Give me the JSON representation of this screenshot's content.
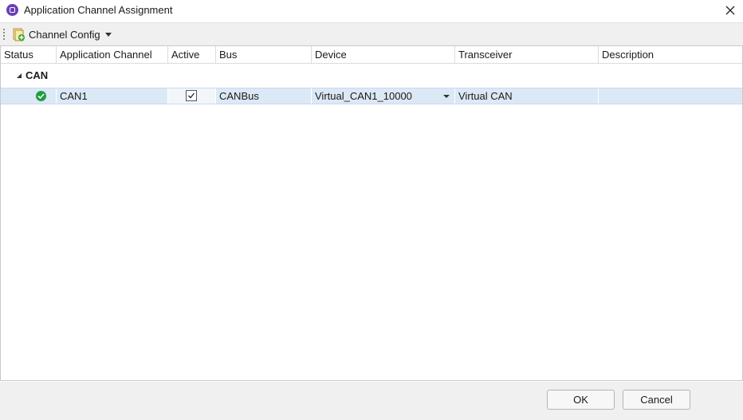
{
  "window": {
    "title": "Application Channel Assignment",
    "icon": "app-icon"
  },
  "toolbar": {
    "channel_config_label": "Channel Config"
  },
  "grid": {
    "columns": [
      "Status",
      "Application Channel",
      "Active",
      "Bus",
      "Device",
      "Transceiver",
      "Description"
    ],
    "group": {
      "label": "CAN",
      "expanded": true
    },
    "rows": [
      {
        "status": "ok",
        "channel": "CAN1",
        "active": true,
        "bus": "CANBus",
        "device": "Virtual_CAN1_10000",
        "transceiver": "Virtual CAN",
        "description": ""
      }
    ]
  },
  "footer": {
    "ok_label": "OK",
    "cancel_label": "Cancel"
  },
  "colors": {
    "selected_row": "#dce8f6",
    "status_ok": "#1e9e3e",
    "app_icon": "#6a3fb5"
  }
}
